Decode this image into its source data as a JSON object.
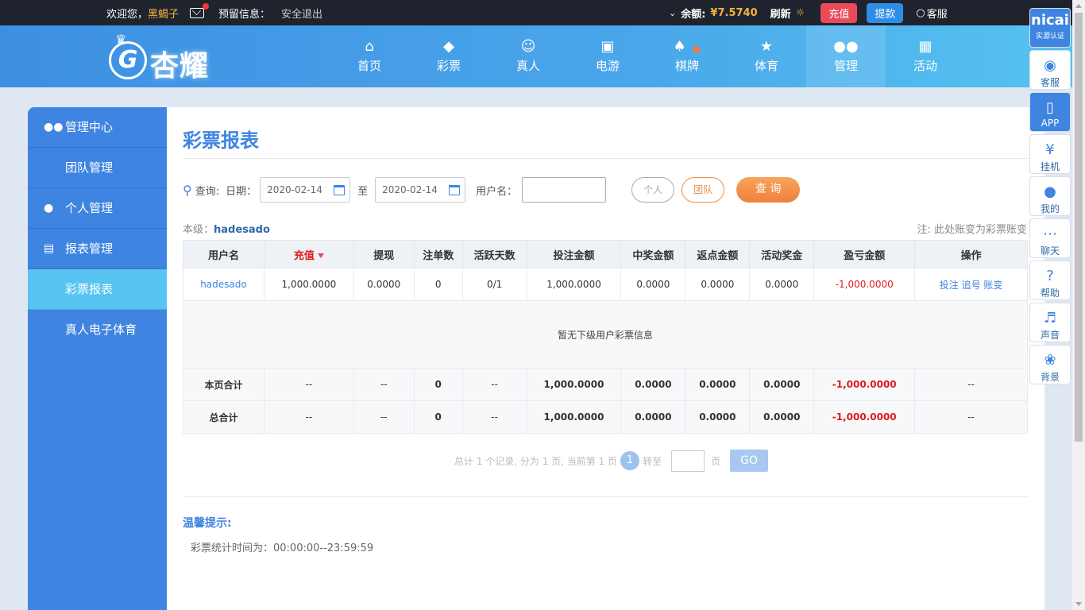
{
  "topbar": {
    "welcome": "欢迎您，",
    "username": "黑蝎子",
    "reserve_info": "预留信息：",
    "logout": "安全退出",
    "balance_label": "余额:",
    "balance_value": "¥7.5740",
    "refresh": "刷新",
    "recharge": "充值",
    "withdraw": "提款",
    "service": "客服"
  },
  "nav": {
    "logo_text": "杏耀",
    "items": [
      {
        "label": "首页",
        "icon": "home-icon"
      },
      {
        "label": "彩票",
        "icon": "lottery-icon"
      },
      {
        "label": "真人",
        "icon": "live-icon"
      },
      {
        "label": "电游",
        "icon": "slot-icon"
      },
      {
        "label": "棋牌",
        "icon": "cards-icon"
      },
      {
        "label": "体育",
        "icon": "trophy-icon"
      },
      {
        "label": "管理",
        "icon": "manage-icon"
      },
      {
        "label": "活动",
        "icon": "gift-icon"
      }
    ],
    "active": "管理"
  },
  "sidebar": {
    "items": [
      {
        "label": "管理中心",
        "type": "head",
        "icon": "users-icon"
      },
      {
        "label": "团队管理",
        "type": "sub"
      },
      {
        "label": "个人管理",
        "type": "head",
        "icon": "user-icon"
      },
      {
        "label": "报表管理",
        "type": "head",
        "icon": "report-icon"
      },
      {
        "label": "彩票报表",
        "type": "sub",
        "active": true
      },
      {
        "label": "真人电子体育",
        "type": "sub"
      }
    ]
  },
  "page": {
    "title": "彩票报表",
    "query_label": "查询:",
    "date_label": "日期：",
    "date_from": "2020-02-14",
    "to_label": "至",
    "date_to": "2020-02-14",
    "username_label": "用户名：",
    "username_value": "",
    "btn_personal": "个人",
    "btn_team": "团队",
    "btn_search": "查 询",
    "level_label": "本级：",
    "level_value": "hadesado",
    "note": "注: 此处账变为彩票账变"
  },
  "table": {
    "headers": [
      "用户名",
      "充值",
      "提现",
      "注单数",
      "活跃天数",
      "投注金额",
      "中奖金额",
      "返点金额",
      "活动奖金",
      "盈亏金额",
      "操作"
    ],
    "row": {
      "username": "hadesado",
      "recharge": "1,000.0000",
      "withdraw": "0.0000",
      "orders": "0",
      "active_days": "0/1",
      "bet": "1,000.0000",
      "win": "0.0000",
      "rebate": "0.0000",
      "bonus": "0.0000",
      "profit": "-1,000.0000",
      "actions": [
        "投注",
        "追号",
        "账变"
      ]
    },
    "empty_message": "暂无下级用户彩票信息",
    "page_total": {
      "label": "本页合计",
      "recharge": "--",
      "withdraw": "--",
      "orders": "0",
      "active_days": "--",
      "bet": "1,000.0000",
      "win": "0.0000",
      "rebate": "0.0000",
      "bonus": "0.0000",
      "profit": "-1,000.0000",
      "actions": "--"
    },
    "grand_total": {
      "label": "总合计",
      "recharge": "--",
      "withdraw": "--",
      "orders": "0",
      "active_days": "--",
      "bet": "1,000.0000",
      "win": "0.0000",
      "rebate": "0.0000",
      "bonus": "0.0000",
      "profit": "-1,000.0000",
      "actions": "--"
    }
  },
  "pager": {
    "summary": "总计 1 个记录, 分为 1 页, 当前第 1 页",
    "current": "1",
    "goto_label": "转至",
    "page_unit": "页",
    "go": "GO"
  },
  "tips": {
    "title": "温馨提示:",
    "content": "彩票统计时间为：00:00:00--23:59:59"
  },
  "rightbar": {
    "ncai_big": "nicai",
    "ncai_small": "实源认证",
    "items": [
      "客服",
      "APP",
      "挂机",
      "我的",
      "聊天",
      "帮助",
      "声音",
      "背景"
    ]
  },
  "colors": {
    "accent": "#3f84e0",
    "nav_end": "#55c3f0",
    "topbar": "#1f232d",
    "loss": "#e01a1a",
    "orange": "#f08b45"
  }
}
